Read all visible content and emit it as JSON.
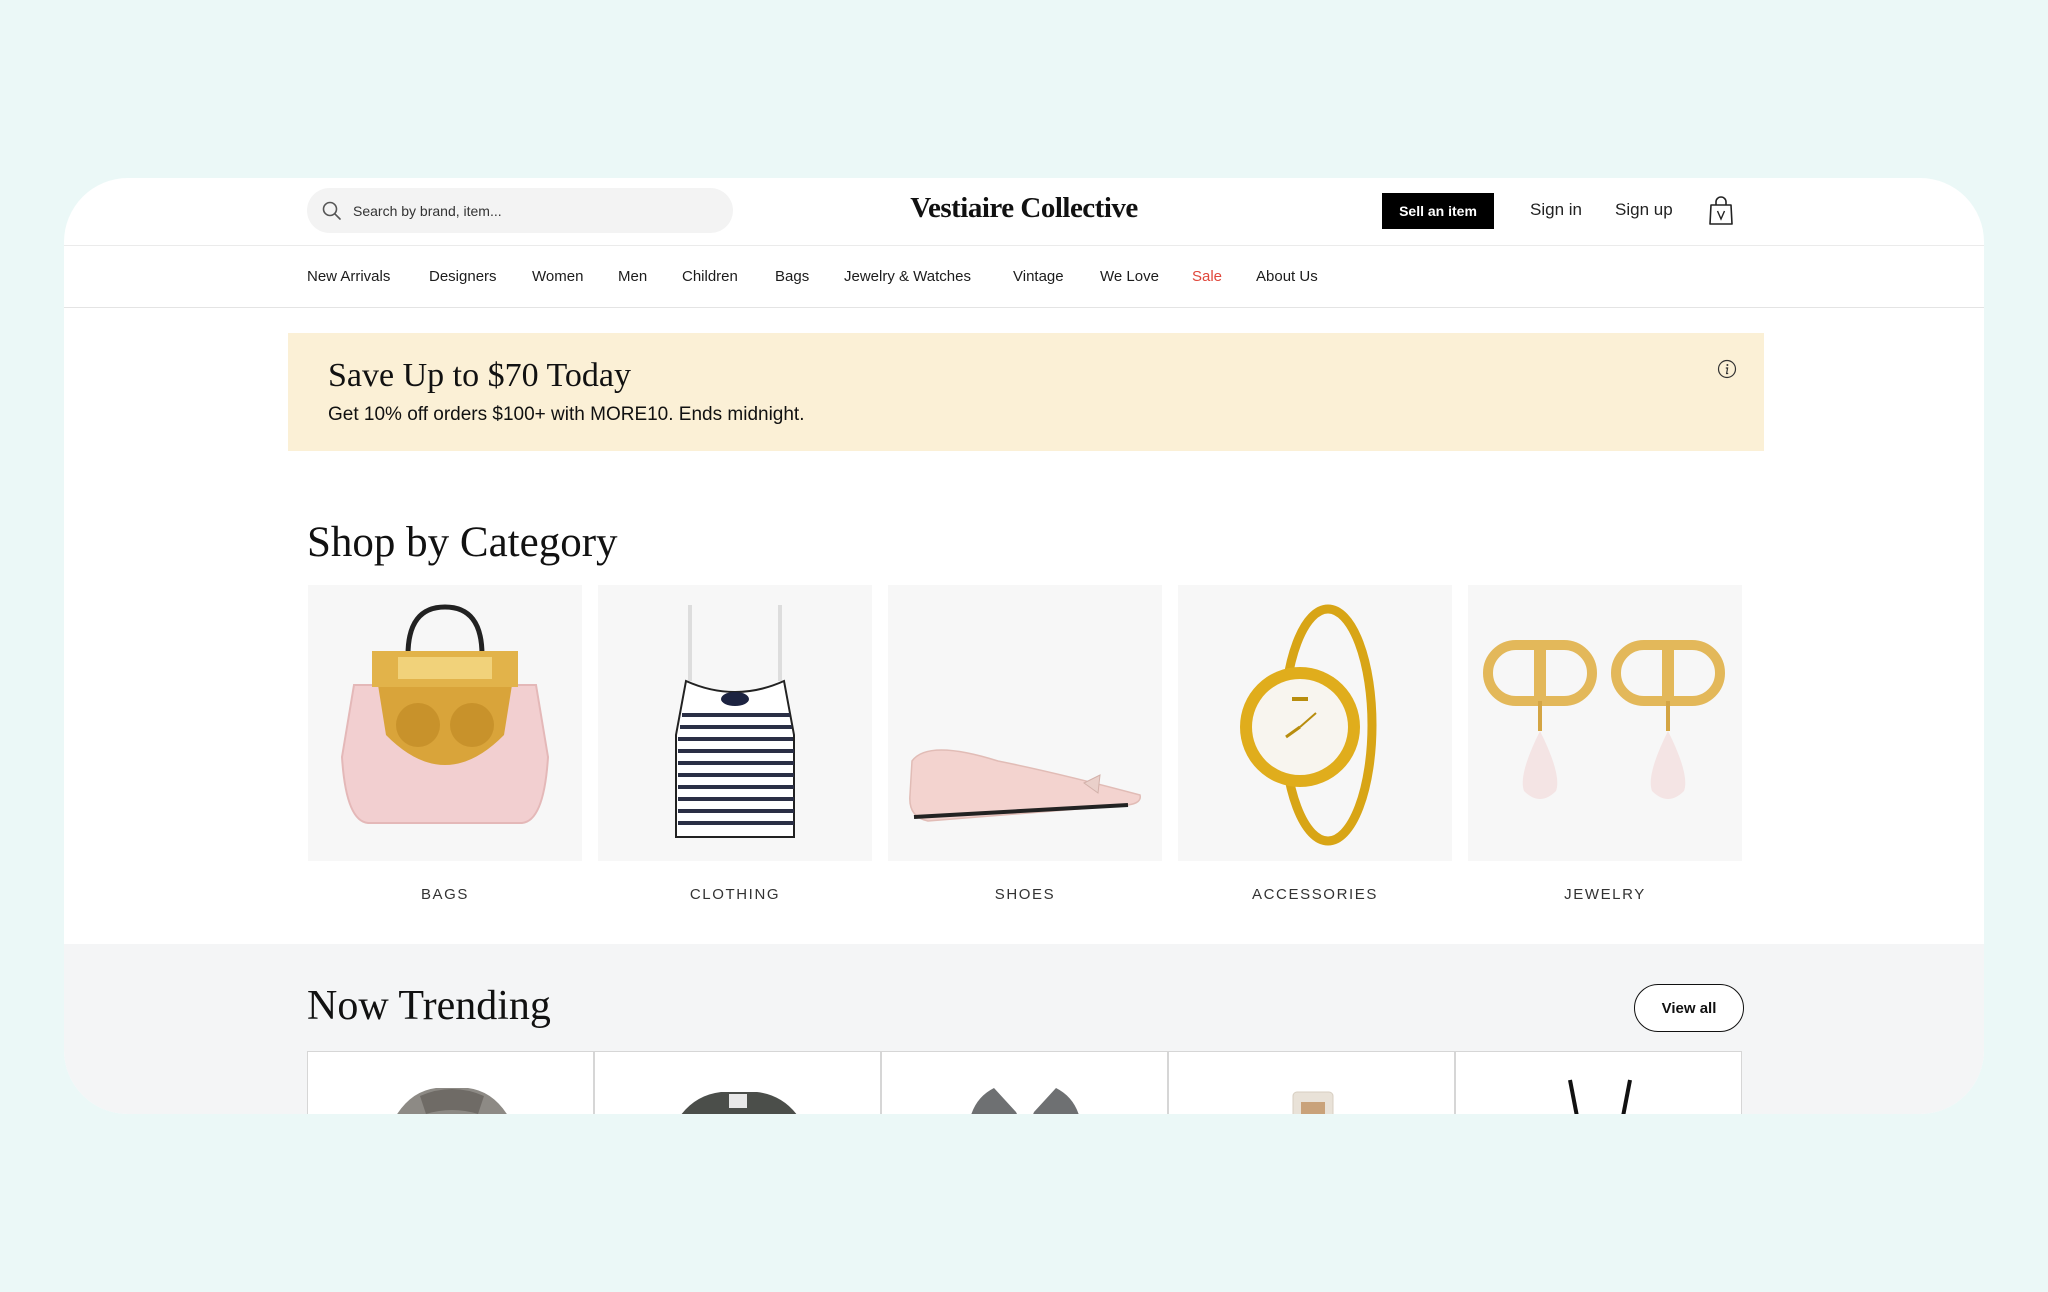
{
  "header": {
    "search_placeholder": "Search by brand, item...",
    "logo": "Vestiaire Collective",
    "sell_label": "Sell an item",
    "sign_in": "Sign in",
    "sign_up": "Sign up"
  },
  "nav": {
    "items": [
      "New Arrivals",
      "Designers",
      "Women",
      "Men",
      "Children",
      "Bags",
      "Jewelry & Watches",
      "Vintage",
      "We Love",
      "Sale",
      "About Us"
    ]
  },
  "promo": {
    "title": "Save Up to $70 Today",
    "subtitle": "Get 10% off orders $100+ with MORE10. Ends midnight."
  },
  "categories": {
    "heading": "Shop by Category",
    "items": [
      "BAGS",
      "CLOTHING",
      "SHOES",
      "ACCESSORIES",
      "JEWELRY"
    ]
  },
  "trending": {
    "heading": "Now Trending",
    "view_all": "View all"
  },
  "colors": {
    "page_bg": "#ebf8f7",
    "promo_bg": "#fbf0d6",
    "sale": "#e0463a",
    "trending_bg": "#f4f5f6"
  }
}
